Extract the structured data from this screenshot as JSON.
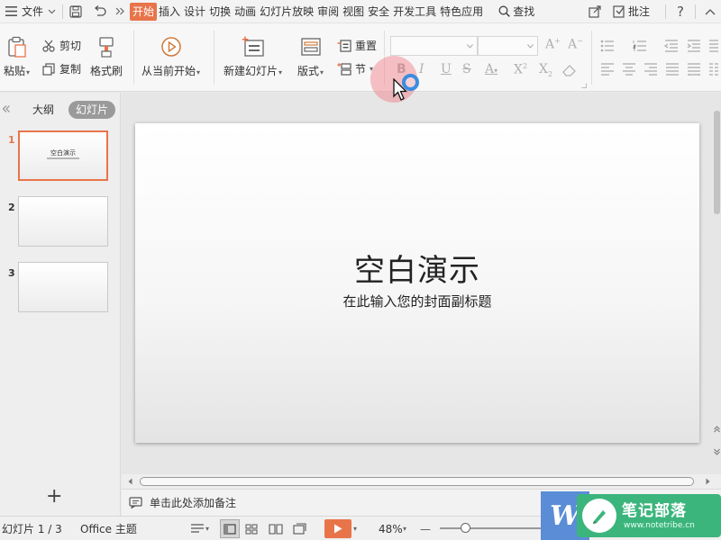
{
  "menubar": {
    "file_label": "文件",
    "tabs": [
      "开始",
      "插入",
      "设计",
      "切换",
      "动画",
      "幻灯片放映",
      "审阅",
      "视图",
      "安全",
      "开发工具",
      "特色应用"
    ],
    "search_label": "查找",
    "comment_label": "批注",
    "help_label": "?"
  },
  "ribbon": {
    "paste_label": "粘贴",
    "cut_label": "剪切",
    "copy_label": "复制",
    "format_painter_label": "格式刷",
    "from_current_label": "从当前开始",
    "new_slide_label": "新建幻灯片",
    "layout_label": "版式",
    "reset_label": "重置",
    "section_label": "节"
  },
  "left_panel": {
    "outline_tab": "大纲",
    "slides_tab": "幻灯片",
    "slides": [
      {
        "number": "1",
        "title": "空白演示"
      },
      {
        "number": "2",
        "title": ""
      },
      {
        "number": "3",
        "title": ""
      }
    ],
    "add_label": "+"
  },
  "slide": {
    "title": "空白演示",
    "subtitle": "在此输入您的封面副标题"
  },
  "notes": {
    "placeholder": "单击此处添加备注"
  },
  "statusbar": {
    "slide_info": "幻灯片 1 / 3",
    "theme": "Office 主题",
    "zoom": "48%",
    "zoom_minus": "—"
  },
  "watermark": {
    "logo_letter": "W",
    "title": "笔记部落",
    "url": "www.notetribe.cn"
  },
  "colors": {
    "accent": "#e8744a",
    "cursor_ring": "#3b8de0"
  }
}
